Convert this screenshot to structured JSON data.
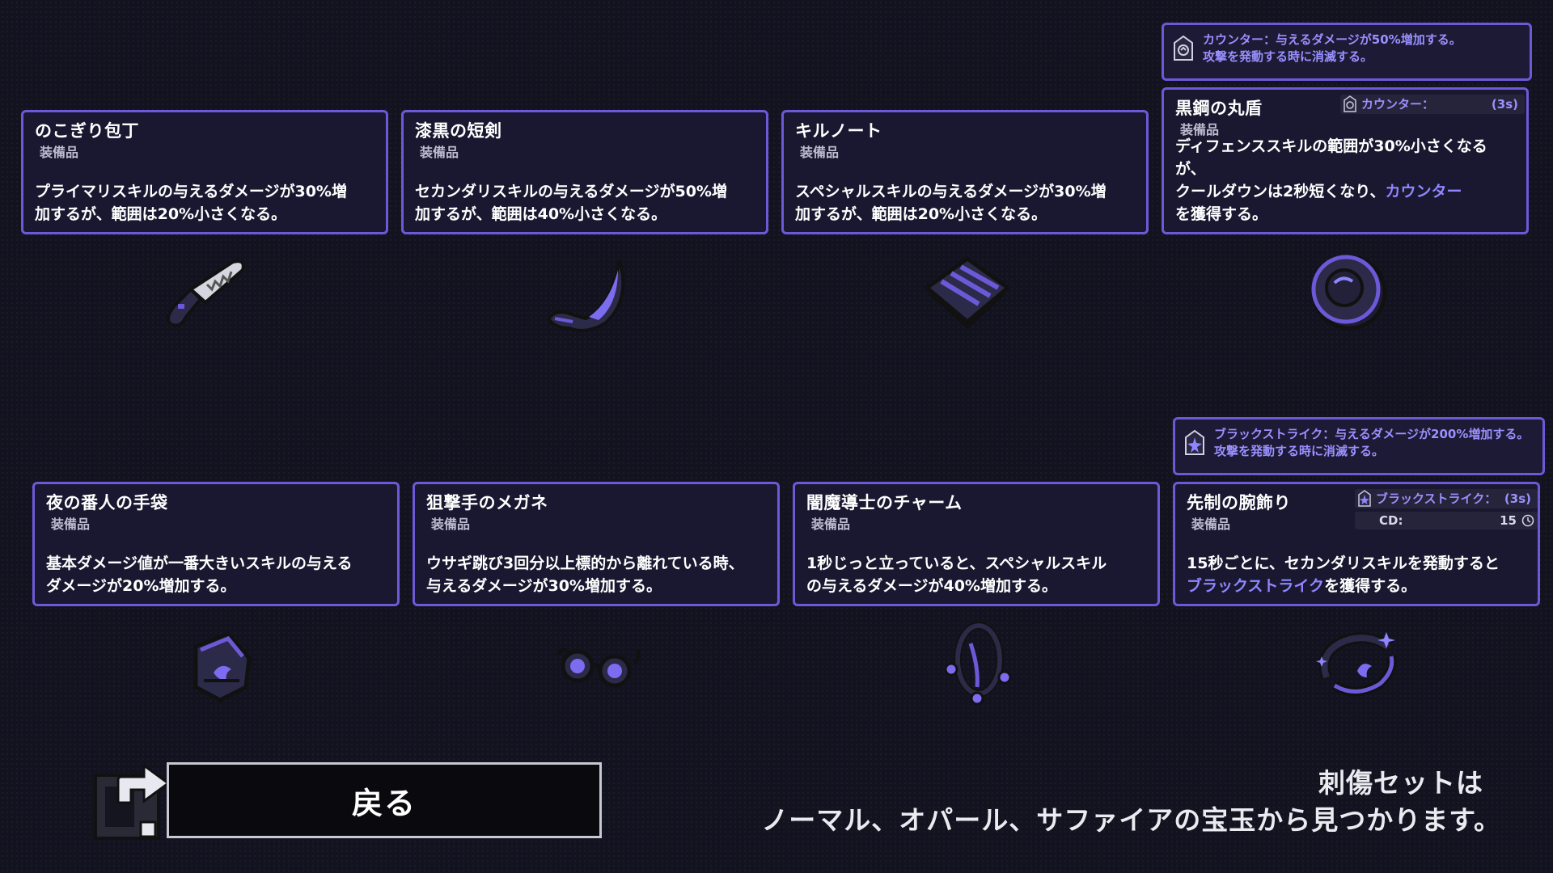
{
  "cards": [
    {
      "name": "のこぎり包丁",
      "type": "装備品",
      "desc1": "プライマリスキルの与えるダメージが30%増",
      "desc2": "加するが、範囲は20%小さくなる。"
    },
    {
      "name": "漆黒の短剣",
      "type": "装備品",
      "desc1": "セカンダリスキルの与えるダメージが50%増",
      "desc2": "加するが、範囲は40%小さくなる。"
    },
    {
      "name": "キルノート",
      "type": "装備品",
      "desc1": "スペシャルスキルの与えるダメージが30%増",
      "desc2": "加するが、範囲は20%小さくなる。"
    },
    {
      "name": "黒鋼の丸盾",
      "type": "装備品",
      "desc1": "ディフェンススキルの範囲が30%小さくなるが、",
      "desc2a": "クールダウンは2秒短くなり、",
      "desc2_hl": "カウンター",
      "desc3": "を獲得する。"
    },
    {
      "name": "夜の番人の手袋",
      "type": "装備品",
      "desc1": "基本ダメージ値が一番大きいスキルの与える",
      "desc2": "ダメージが20%増加する。"
    },
    {
      "name": "狙撃手のメガネ",
      "type": "装備品",
      "desc1": "ウサギ跳び3回分以上標的から離れている時、",
      "desc2": "与えるダメージが30%増加する。"
    },
    {
      "name": "闇魔導士のチャーム",
      "type": "装備品",
      "desc1": "1秒じっと立っていると、スペシャルスキル",
      "desc2": "の与えるダメージが40%増加する。"
    },
    {
      "name": "先制の腕飾り",
      "type": "装備品",
      "desc1": "15秒ごとに、セカンダリスキルを発動すると",
      "desc2_hl": "ブラックストライク",
      "desc2b": "を獲得する。"
    }
  ],
  "tooltips": {
    "counter": {
      "line1": "カウンター：与えるダメージが50%増加する。",
      "line2": "攻撃を発動する時に消滅する。"
    },
    "blackstrike": {
      "line1": "ブラックストライク：与えるダメージが200%増加する。",
      "line2": "攻撃を発動する時に消滅する。"
    }
  },
  "status": {
    "counter": {
      "label": "カウンター：",
      "duration": "(3s)"
    },
    "blackstrike": {
      "label": "ブラックストライク：",
      "duration": "(3s)"
    },
    "cooldown": {
      "label": "CD:",
      "value": "15"
    }
  },
  "back_label": "戻る",
  "footer": {
    "line1": "刺傷セットは",
    "line2": "ノーマル、オパール、サファイアの宝玉から見つかります。"
  },
  "colors": {
    "accent": "#6b5ad8",
    "highlight": "#8f86ff",
    "panel": "#1a1830",
    "background": "#131320"
  },
  "icons": [
    "serrated-knife-icon",
    "dark-dagger-icon",
    "kill-note-icon",
    "round-shield-icon",
    "gloves-icon",
    "glasses-icon",
    "charm-icon",
    "bracelet-icon"
  ]
}
